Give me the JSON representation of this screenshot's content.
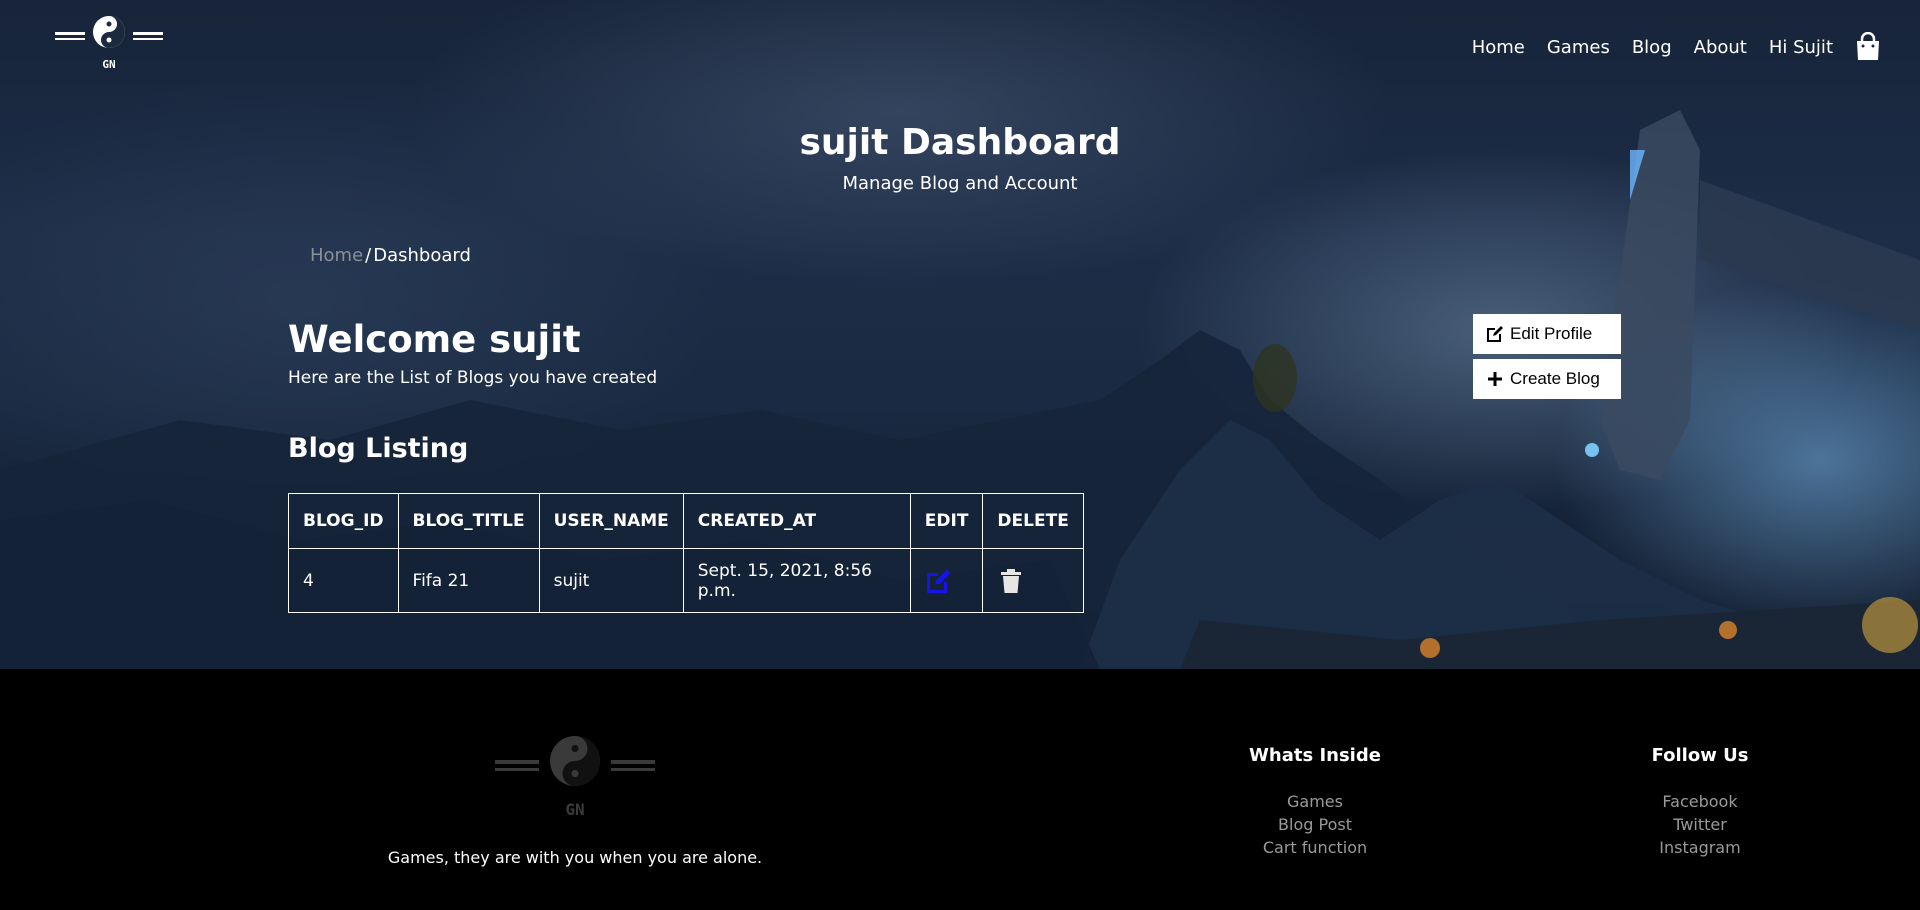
{
  "brand": {
    "logo_text": "GN"
  },
  "nav": {
    "items": [
      {
        "label": "Home"
      },
      {
        "label": "Games"
      },
      {
        "label": "Blog"
      },
      {
        "label": "About"
      },
      {
        "label": "Hi Sujit"
      }
    ],
    "cart_icon": "shopping-bag-icon"
  },
  "hero": {
    "title": "sujit Dashboard",
    "subtitle": "Manage Blog and Account"
  },
  "breadcrumb": {
    "home": "Home",
    "separator": "/",
    "current": "Dashboard"
  },
  "welcome": {
    "heading": "Welcome sujit",
    "subtext": "Here are the List of Blogs you have created"
  },
  "actions": {
    "edit_profile": "Edit Profile",
    "create_blog": "Create Blog"
  },
  "listing": {
    "title": "Blog Listing",
    "columns": [
      "BLOG_ID",
      "BLOG_TITLE",
      "USER_NAME",
      "CREATED_AT",
      "EDIT",
      "DELETE"
    ],
    "rows": [
      {
        "blog_id": "4",
        "blog_title": "Fifa 21",
        "user_name": "sujit",
        "created_at": "Sept. 15, 2021, 8:56 p.m.",
        "edit_icon": "edit-icon",
        "delete_icon": "trash-icon"
      }
    ]
  },
  "footer": {
    "logo_text": "GN",
    "tagline": "Games, they are with you when you are alone.",
    "whats_inside": {
      "heading": "Whats Inside",
      "links": [
        "Games",
        "Blog Post",
        "Cart function"
      ]
    },
    "follow_us": {
      "heading": "Follow Us",
      "links": [
        "Facebook",
        "Twitter",
        "Instagram"
      ]
    }
  },
  "colors": {
    "edit_icon": "#1515e6",
    "breadcrumb_home": "#8a8f98",
    "footer_link": "#9a9a9a",
    "footer_bg": "#000000"
  }
}
